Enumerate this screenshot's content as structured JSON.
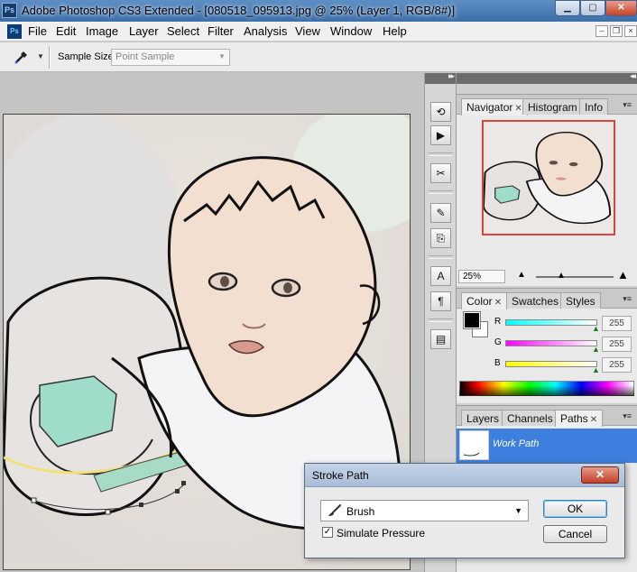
{
  "window": {
    "title": "Adobe Photoshop CS3 Extended - [080518_095913.jpg @ 25% (Layer 1, RGB/8#)]",
    "app_logo": "Ps",
    "doc_logo": "Ps"
  },
  "menu": {
    "items": [
      "File",
      "Edit",
      "Image",
      "Layer",
      "Select",
      "Filter",
      "Analysis",
      "View",
      "Window",
      "Help"
    ]
  },
  "options": {
    "sample_size_label": "Sample Size:",
    "sample_size_value": "Point Sample",
    "tool_icon": "eyedropper-icon"
  },
  "dock": {
    "icons": [
      "history-icon",
      "actions-icon",
      "tool-presets-icon",
      "brushes-icon",
      "clone-source-icon",
      "character-icon",
      "paragraph-icon",
      "layer-comps-icon"
    ]
  },
  "navigator": {
    "tabs": [
      {
        "label": "Navigator",
        "active": true,
        "closable": true
      },
      {
        "label": "Histogram",
        "active": false,
        "closable": false
      },
      {
        "label": "Info",
        "active": false,
        "closable": false
      }
    ],
    "zoom": "25%",
    "view_box_color": "#e0413b"
  },
  "color": {
    "tabs": [
      {
        "label": "Color",
        "active": true,
        "closable": true
      },
      {
        "label": "Swatches",
        "active": false,
        "closable": false
      },
      {
        "label": "Styles",
        "active": false,
        "closable": false
      }
    ],
    "foreground": "#000000",
    "background": "#ffffff",
    "channels": [
      {
        "label": "R",
        "value": "255",
        "gradient_from": "#00ffff",
        "gradient_to": "#ffffff",
        "level": 1.0
      },
      {
        "label": "G",
        "value": "255",
        "gradient_from": "#ff00ff",
        "gradient_to": "#ffffff",
        "level": 1.0
      },
      {
        "label": "B",
        "value": "255",
        "gradient_from": "#ffff00",
        "gradient_to": "#ffffff",
        "level": 1.0
      }
    ]
  },
  "paths": {
    "tabs": [
      {
        "label": "Layers",
        "active": false,
        "closable": false
      },
      {
        "label": "Channels",
        "active": false,
        "closable": false
      },
      {
        "label": "Paths",
        "active": true,
        "closable": true
      }
    ],
    "items": [
      {
        "name": "Work Path",
        "selected": true
      }
    ],
    "selection_color": "#3d7fde"
  },
  "dialog": {
    "title": "Stroke Path",
    "tool_value": "Brush",
    "simulate_pressure_label": "Simulate Pressure",
    "simulate_pressure_checked": true,
    "ok_label": "OK",
    "cancel_label": "Cancel"
  }
}
